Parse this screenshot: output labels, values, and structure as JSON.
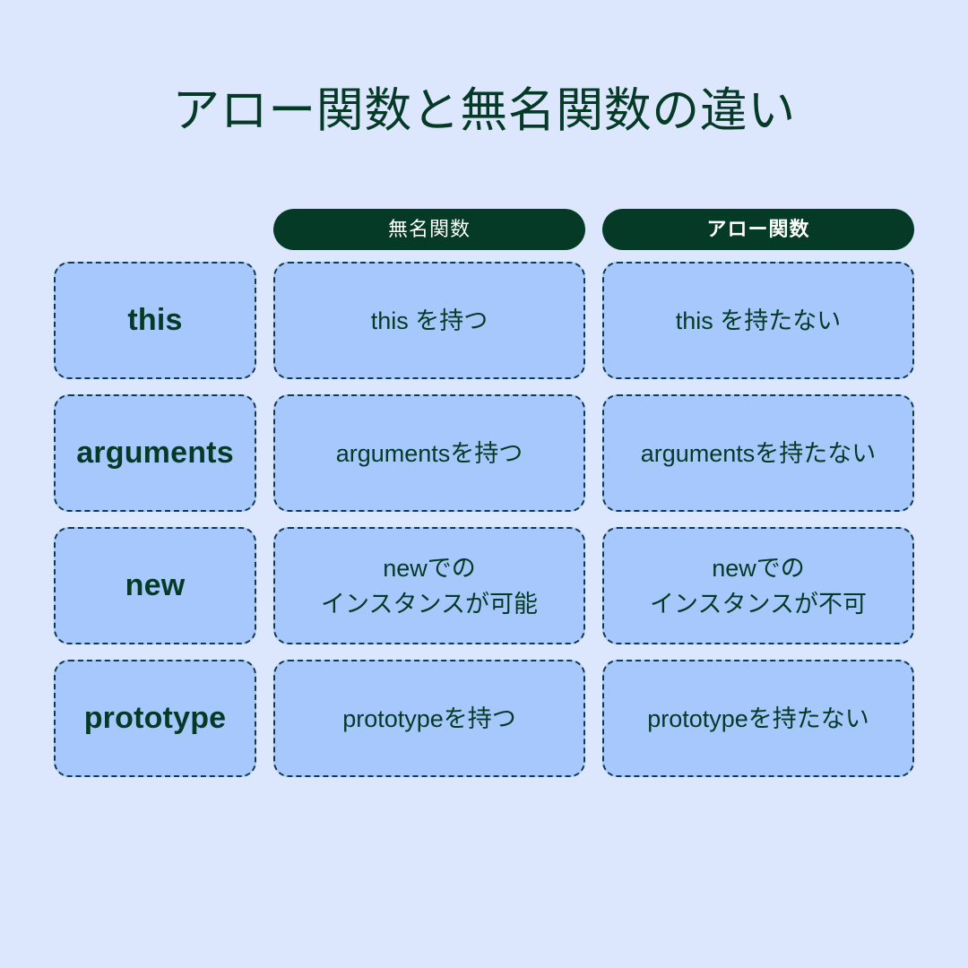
{
  "slide": {
    "title": "アロー関数と無名関数の違い",
    "background_color": "#dce7fe",
    "accent_color": "#053a26",
    "cell_color": "#a6c8fc"
  },
  "table": {
    "columns": [
      {
        "key": "feature",
        "header": ""
      },
      {
        "key": "anonymous",
        "header": "無名関数"
      },
      {
        "key": "arrow",
        "header": "アロー関数"
      }
    ],
    "rows": [
      {
        "label": "this",
        "anonymous": "this を持つ",
        "arrow": "this を持たない"
      },
      {
        "label": "arguments",
        "anonymous": "argumentsを持つ",
        "arrow": "argumentsを持たない"
      },
      {
        "label": "new",
        "anonymous_line1": "newでの",
        "anonymous_line2": "インスタンスが可能",
        "arrow_line1": "newでの",
        "arrow_line2": "インスタンスが不可"
      },
      {
        "label": "prototype",
        "anonymous": "prototypeを持つ",
        "arrow": "prototypeを持たない"
      }
    ]
  }
}
